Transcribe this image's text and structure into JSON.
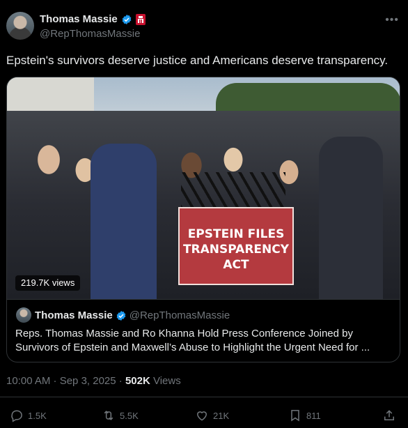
{
  "author": {
    "name": "Thomas Massie",
    "handle": "@RepThomasMassie"
  },
  "tweet": {
    "text": "Epstein's survivors deserve justice and Americans deserve transparency."
  },
  "media": {
    "views": "219.7K views",
    "podium_text": "EPSTEIN FILES TRANSPARENCY ACT"
  },
  "quote": {
    "name": "Thomas Massie",
    "handle": "@RepThomasMassie",
    "text": "Reps. Thomas Massie and Ro Khanna Hold Press Conference Joined by Survivors of Epstein and Maxwell’s Abuse to Highlight the Urgent Need for ..."
  },
  "meta": {
    "time": "10:00 AM · Sep 3, 2025 · ",
    "views_count": "502K",
    "views_label": " Views"
  },
  "actions": {
    "replies": "1.5K",
    "reposts": "5.5K",
    "likes": "21K",
    "bookmarks": "811"
  },
  "colors": {
    "background": "#000000",
    "text": "#e7e9ea",
    "secondary": "#71767b",
    "verified": "#1d9bf0",
    "podium": "#b43a3f"
  }
}
